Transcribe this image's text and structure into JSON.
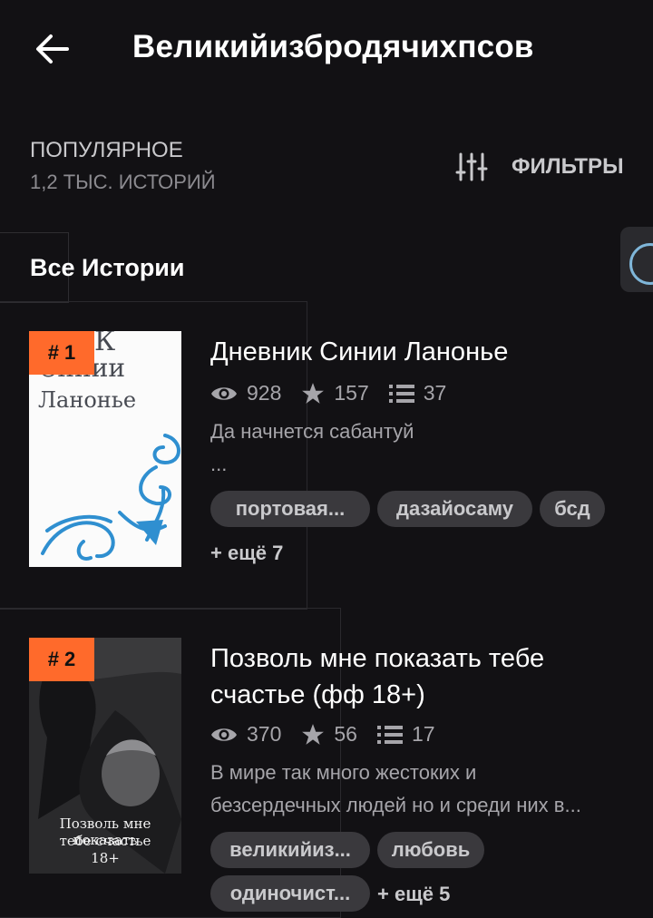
{
  "header": {
    "title": "Великийизбродячихпсов",
    "back_icon": "arrow-left-icon"
  },
  "section": {
    "label": "ПОПУЛЯРНОЕ",
    "count": "1,2 ТЫС. ИСТОРИЙ"
  },
  "filters": {
    "label": "ФИЛЬТРЫ",
    "icon": "sliders-icon"
  },
  "tab": {
    "label": "Все Истории"
  },
  "colors": {
    "background": "#121114",
    "rank_badge": "#ff6a2b",
    "tag_bg": "#3a393d",
    "muted_text": "#a6a5aa"
  },
  "stories": [
    {
      "rank": "# 1",
      "title": "Дневник Синии Ланонье",
      "reads": "928",
      "votes": "157",
      "parts": "37",
      "description": "Да начнется сабантуй",
      "description_more": "...",
      "cover_lines": [
        "К",
        "Синии",
        "Ланонье"
      ],
      "tags": [
        "портовая...",
        "дазайосаму",
        "бсд"
      ],
      "more_tags": "+ ещё 7"
    },
    {
      "rank": "# 2",
      "title_line1": "Позволь мне показать тебе",
      "title_line2": "счастье (фф 18+)",
      "reads": "370",
      "votes": "56",
      "parts": "17",
      "description_line1": "В мире так много жестоких и",
      "description_line2": "безсердечных людей но и среди них в...",
      "cover_lines": [
        "Позволь мне показать",
        "тебе счастье",
        "18+"
      ],
      "tags": [
        "великийиз...",
        "любовь",
        "одиночист..."
      ],
      "more_tags": "+ ещё 5"
    }
  ]
}
